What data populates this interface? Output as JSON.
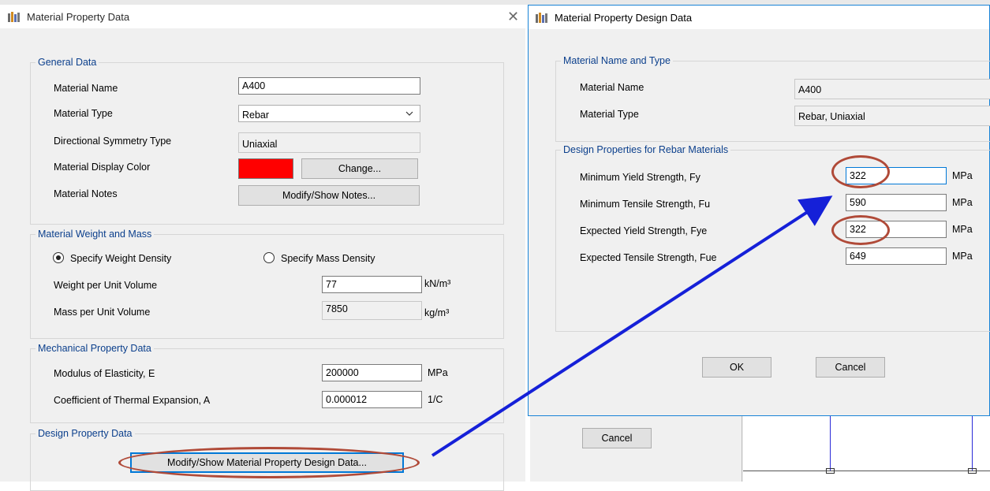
{
  "left_dialog": {
    "title": "Material Property Data",
    "general": {
      "legend": "General Data",
      "material_name_label": "Material Name",
      "material_name_value": "A400",
      "material_type_label": "Material Type",
      "material_type_value": "Rebar",
      "symmetry_label": "Directional Symmetry Type",
      "symmetry_value": "Uniaxial",
      "display_color_label": "Material Display Color",
      "display_color": "#ff0000",
      "change_button": "Change...",
      "notes_label": "Material Notes",
      "notes_button": "Modify/Show Notes..."
    },
    "weight": {
      "legend": "Material Weight and Mass",
      "radio_weight": "Specify Weight Density",
      "radio_mass": "Specify Mass Density",
      "selected": "weight",
      "weight_label": "Weight per Unit Volume",
      "weight_value": "77",
      "weight_unit": "kN/m³",
      "mass_label": "Mass per Unit Volume",
      "mass_value": "7850",
      "mass_unit": "kg/m³"
    },
    "mechanical": {
      "legend": "Mechanical Property Data",
      "modulus_label": "Modulus of Elasticity,  E",
      "modulus_value": "200000",
      "modulus_unit": "MPa",
      "thermal_label": "Coefficient of Thermal Expansion,  A",
      "thermal_value": "0.000012",
      "thermal_unit": "1/C"
    },
    "design": {
      "legend": "Design Property Data",
      "button": "Modify/Show Material Property Design Data..."
    }
  },
  "background_dialog": {
    "cancel_button": "Cancel"
  },
  "right_dialog": {
    "title": "Material Property Design Data",
    "name_type": {
      "legend": "Material Name and Type",
      "name_label": "Material Name",
      "name_value": "A400",
      "type_label": "Material Type",
      "type_value": "Rebar, Uniaxial"
    },
    "design": {
      "legend": "Design Properties for Rebar Materials",
      "rows": [
        {
          "label": "Minimum Yield Strength, Fy",
          "value": "322",
          "unit": "MPa"
        },
        {
          "label": "Minimum Tensile Strength, Fu",
          "value": "590",
          "unit": "MPa"
        },
        {
          "label": "Expected Yield Strength, Fye",
          "value": "322",
          "unit": "MPa"
        },
        {
          "label": "Expected Tensile Strength, Fue",
          "value": "649",
          "unit": "MPa"
        }
      ]
    },
    "ok_button": "OK",
    "cancel_button": "Cancel"
  },
  "colors": {
    "annotation_oval": "#b04a38",
    "annotation_arrow": "#1520d8",
    "focus_border": "#0078d7",
    "group_legend": "#0b3f8c"
  }
}
